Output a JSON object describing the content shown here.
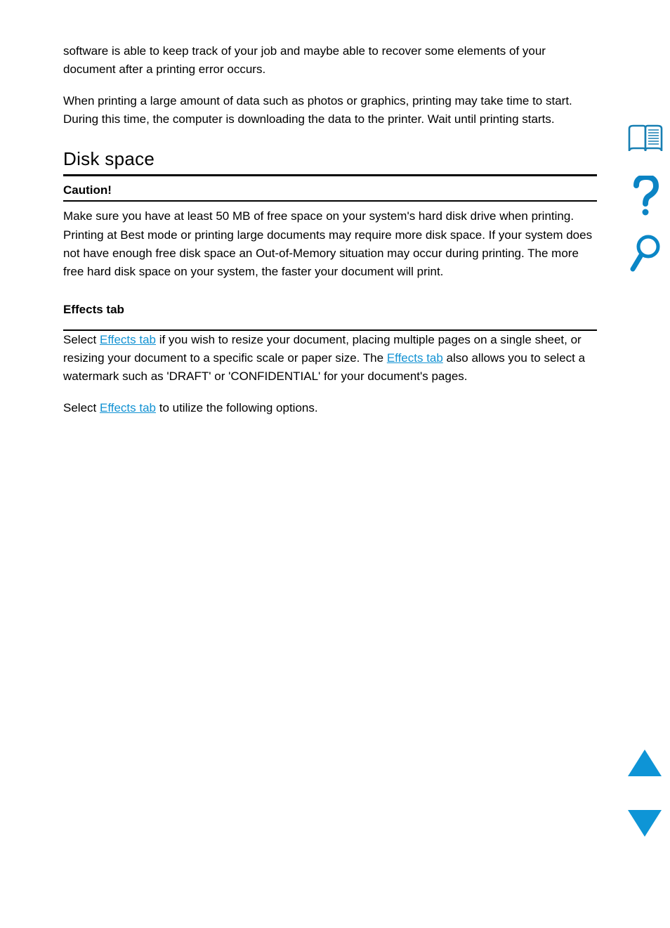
{
  "body": {
    "p1": "software is able to keep track of your job and maybe able to recover some elements of your document after a printing error occurs.",
    "p2": "When printing a large amount of data such as photos or graphics, printing may take time to start. During this time, the computer is downloading the data to the printer. Wait until printing starts.",
    "section_title": "Disk space",
    "caution_label": "Caution!",
    "caution_body": "Make sure you have at least 50 MB of free space on your system's hard disk drive when printing. Printing at Best mode or printing large documents may require more disk space. If your system does not have enough free disk space an Out-of-Memory situation may occur during printing. The more free hard disk space on your system, the faster your document will print.",
    "effects_heading": "Effects tab",
    "p3_a": "Select ",
    "p3_link": "Effects tab",
    "p3_b": " if you wish to resize your document, placing multiple pages on a single sheet, or resizing your document to a specific scale or paper size. The ",
    "p3_c": " also allows you to select a watermark such as 'DRAFT' or 'CONFIDENTIAL' for your document's pages.",
    "p4_a": "Select ",
    "p4_link": "Effects tab",
    "p4_b": " to utilize the following options."
  },
  "nav": {
    "contents": "contents-icon",
    "help": "help-icon",
    "search": "search-icon",
    "prev": "previous-page-button",
    "next": "next-page-button"
  }
}
